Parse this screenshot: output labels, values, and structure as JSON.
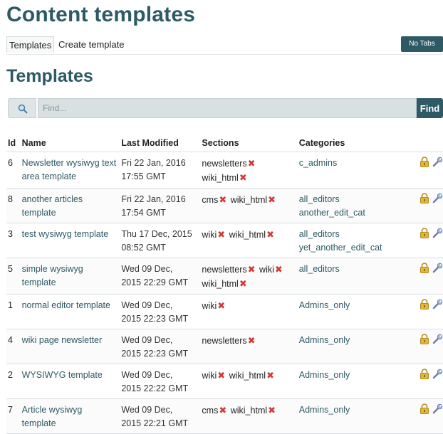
{
  "page": {
    "title": "Content templates"
  },
  "tabs": {
    "items": [
      {
        "label": "Templates"
      },
      {
        "label": "Create template"
      }
    ],
    "no_tabs_label": "No Tabs"
  },
  "templates_section": {
    "title": "Templates"
  },
  "search": {
    "placeholder": "Find...",
    "value": "",
    "button_label": "Find"
  },
  "table": {
    "headers": {
      "id": "Id",
      "name": "Name",
      "last_modified": "Last Modified",
      "sections": "Sections",
      "categories": "Categories"
    },
    "rows": [
      {
        "id": "6",
        "name": "Newsletter wysiwyg text area template",
        "modified": [
          "Fri 22 Jan, 2016",
          "17:55 GMT"
        ],
        "sections": [
          "newsletters",
          "wiki_html"
        ],
        "categories": [
          "c_admins"
        ]
      },
      {
        "id": "8",
        "name": "another articles template",
        "modified": [
          "Fri 22 Jan, 2016",
          "17:54 GMT"
        ],
        "sections": [
          "cms",
          "wiki_html"
        ],
        "categories": [
          "all_editors",
          "another_edit_cat"
        ]
      },
      {
        "id": "3",
        "name": "test wysiwyg template",
        "modified": [
          "Thu 17 Dec, 2015",
          "08:52 GMT"
        ],
        "sections": [
          "wiki",
          "wiki_html"
        ],
        "categories": [
          "all_editors",
          "yet_another_edit_cat"
        ]
      },
      {
        "id": "5",
        "name": "simple wysiwyg template",
        "modified": [
          "Wed 09 Dec,",
          "2015 22:29 GMT"
        ],
        "sections": [
          "newsletters",
          "wiki",
          "wiki_html"
        ],
        "categories": [
          "all_editors"
        ]
      },
      {
        "id": "1",
        "name": "normal editor template",
        "modified": [
          "Wed 09 Dec,",
          "2015 22:23 GMT"
        ],
        "sections": [
          "wiki"
        ],
        "categories": [
          "Admins_only"
        ]
      },
      {
        "id": "4",
        "name": "wiki page newsletter",
        "modified": [
          "Wed 09 Dec,",
          "2015 22:23 GMT"
        ],
        "sections": [
          "newsletters"
        ],
        "categories": [
          "Admins_only"
        ]
      },
      {
        "id": "2",
        "name": "WYSIWYG template",
        "modified": [
          "Wed 09 Dec,",
          "2015 22:22 GMT"
        ],
        "sections": [
          "wiki",
          "wiki_html"
        ],
        "categories": [
          "Admins_only"
        ]
      },
      {
        "id": "7",
        "name": "Article wysiwyg template",
        "modified": [
          "Wed 09 Dec,",
          "2015 22:21 GMT"
        ],
        "sections": [
          "cms",
          "wiki_html"
        ],
        "categories": [
          "Admins_only"
        ]
      }
    ]
  },
  "icons": {
    "search": "search-icon",
    "remove": "remove-x-icon",
    "permissions": "lock-icon",
    "edit": "wrench-icon"
  },
  "colors": {
    "accent": "#2e5a66",
    "remove": "#d23a3a",
    "lock": "#e3b63a"
  }
}
